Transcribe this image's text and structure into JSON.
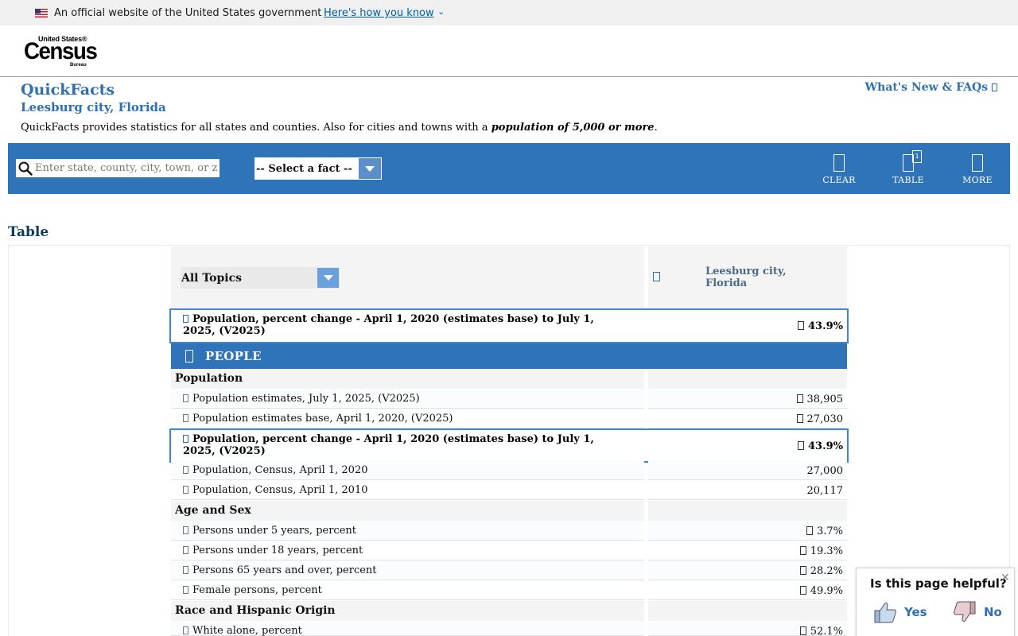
{
  "gov_banner": {
    "text": "An official website of the United States government",
    "link": "Here's how you know"
  },
  "logo": {
    "top": "United States®",
    "main": "Census",
    "bottom": "Bureau"
  },
  "title": {
    "main": "QuickFacts",
    "location": "Leesburg city, Florida",
    "desc_prefix": "QuickFacts provides statistics for all states and counties. Also for cities and towns with a ",
    "desc_bold": "population of 5,000 or more",
    "desc_suffix": ".",
    "whats_new": "What's New & FAQs"
  },
  "toolbar": {
    "search_placeholder": "Enter state, county, city, town, or zip code",
    "fact_select": "-- Select a fact --",
    "clear": "CLEAR",
    "table": "TABLE",
    "table_badge": "1",
    "more": "MORE"
  },
  "section_title": "Table",
  "table": {
    "topics": "All Topics",
    "geo": "Leesburg city, Florida",
    "highlight": {
      "label": "Population, percent change - April 1, 2020 (estimates base) to July 1, 2025, (V2025)",
      "value": "43.9%"
    },
    "people": "PEOPLE",
    "population_head": "Population",
    "population_rows": [
      {
        "label": "Population estimates, July 1, 2025, (V2025)",
        "value": "38,905"
      },
      {
        "label": "Population estimates base, April 1, 2020, (V2025)",
        "value": "27,030"
      }
    ],
    "population_change": {
      "label": "Population, percent change - April 1, 2020 (estimates base) to July 1, 2025, (V2025)",
      "value": "43.9%"
    },
    "census_rows": [
      {
        "label": "Population, Census, April 1, 2020",
        "value": "27,000"
      },
      {
        "label": "Population, Census, April 1, 2010",
        "value": "20,117"
      }
    ],
    "age_head": "Age and Sex",
    "age_rows": [
      {
        "label": "Persons under 5 years, percent",
        "value": "3.7%"
      },
      {
        "label": "Persons under 18 years, percent",
        "value": "19.3%"
      },
      {
        "label": "Persons 65 years and over, percent",
        "value": "28.2%"
      },
      {
        "label": "Female persons, percent",
        "value": "49.9%"
      }
    ],
    "race_head": "Race and Hispanic Origin",
    "race_rows": [
      {
        "label": "White alone, percent",
        "value": "52.1%"
      }
    ]
  },
  "helpful": {
    "question": "Is this page helpful?",
    "yes": "Yes",
    "no": "No"
  },
  "colors": {
    "brand_blue": "#2f74b8",
    "link_blue": "#2f6fb4"
  }
}
